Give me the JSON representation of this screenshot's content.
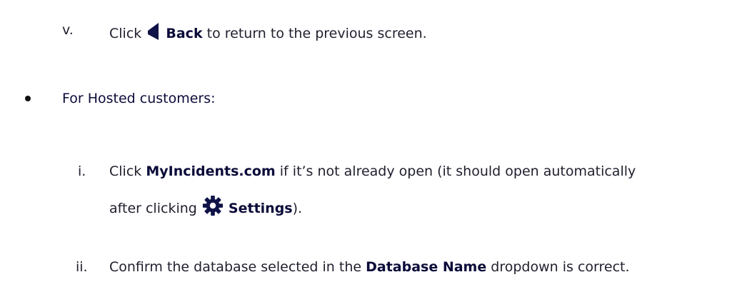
{
  "step_v": {
    "marker": "v.",
    "prefix": "Click",
    "bold": "Back",
    "suffix": "to return to the previous screen.",
    "icon": "back-triangle-icon"
  },
  "hosted": {
    "heading": "For Hosted customers:"
  },
  "step_i": {
    "marker": "i.",
    "prefix": "Click",
    "bold": "MyIncidents.com",
    "suffix": "if it’s not already open (it should open automatically",
    "line2_prefix": "after clicking",
    "line2_bold": "Settings",
    "line2_suffix": ").",
    "icon": "gear-icon"
  },
  "step_ii": {
    "marker": "ii.",
    "prefix": "Confirm the database selected in the",
    "bold": "Database Name",
    "suffix": "dropdown is correct."
  }
}
